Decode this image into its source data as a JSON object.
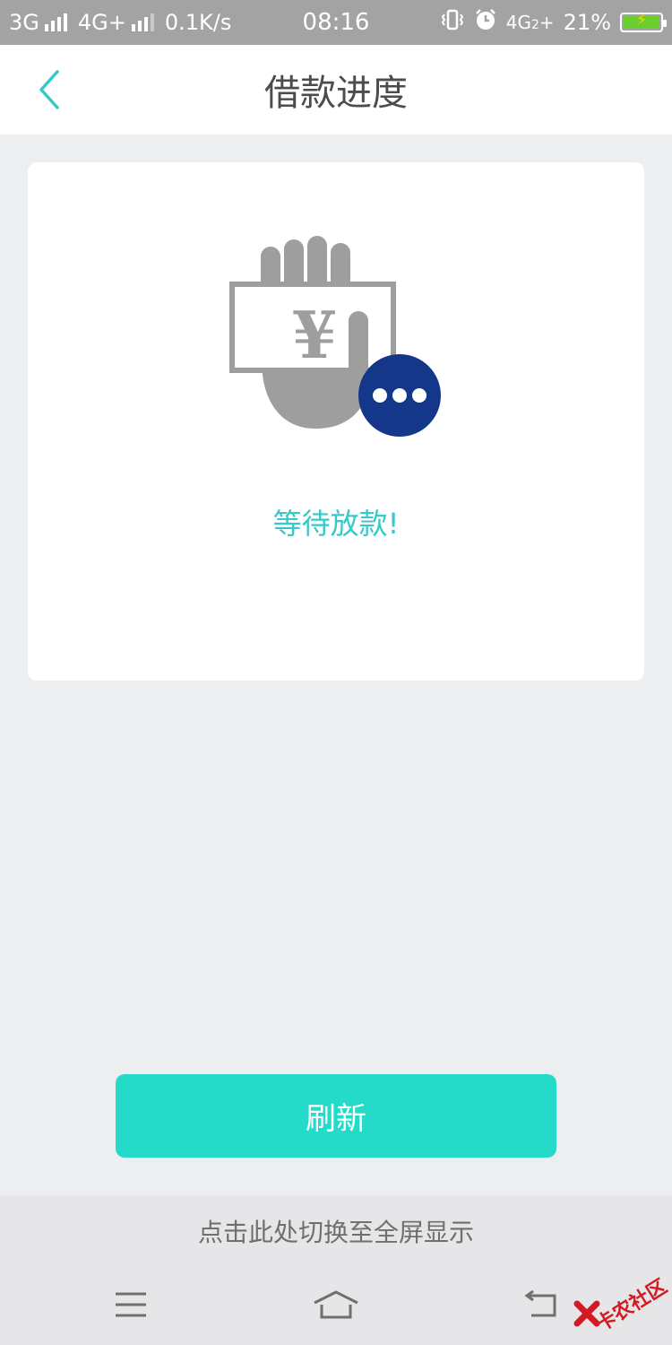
{
  "status_bar": {
    "network1": "3G",
    "network2": "4G+",
    "speed": "0.1K/s",
    "time": "08:16",
    "network3": "4G",
    "sim_index": "2",
    "battery": "21%"
  },
  "header": {
    "title": "借款进度"
  },
  "card": {
    "currency_symbol": "¥",
    "status_text": "等待放款!"
  },
  "actions": {
    "refresh_label": "刷新"
  },
  "hint": {
    "fullscreen_text": "点击此处切换至全屏显示"
  },
  "watermark": {
    "text": "卡农社区"
  },
  "colors": {
    "accent": "#24dac8",
    "status_text": "#35c9c7",
    "badge": "#14378a",
    "background": "#edeef0"
  }
}
